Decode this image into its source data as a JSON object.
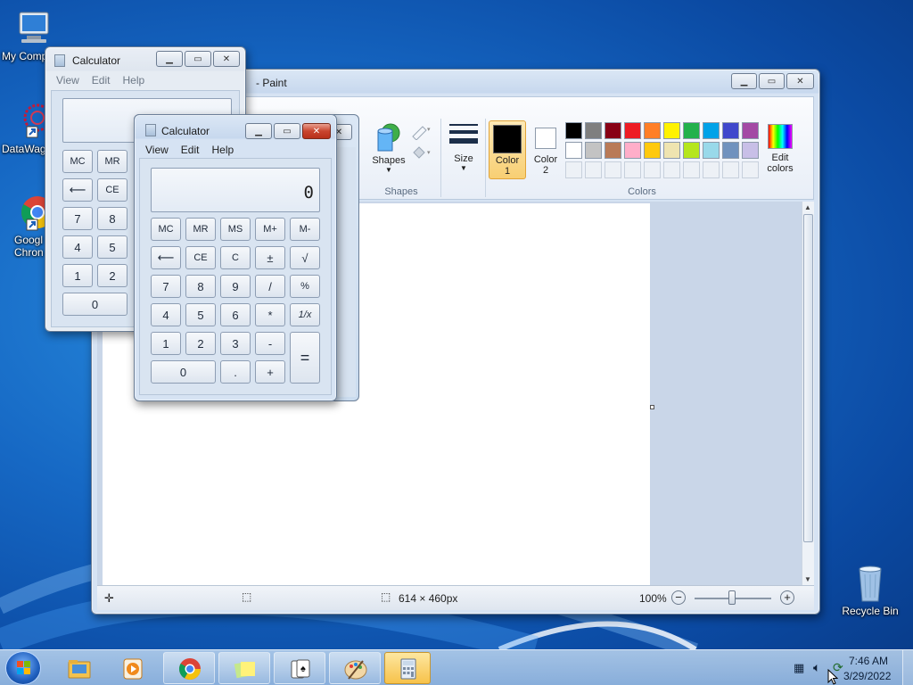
{
  "desktop": {
    "icons": [
      {
        "label": "My Comp"
      },
      {
        "label": "DataWag"
      },
      {
        "label": "Googl\nChron"
      },
      {
        "label": "Recycle Bin"
      }
    ]
  },
  "paint": {
    "title": "- Paint",
    "shapes_label": "Shapes",
    "shapes_group_label": "Shapes",
    "size_label": "Size",
    "color1_label": "Color\n1",
    "color2_label": "Color\n2",
    "edit_colors_label": "Edit\ncolors",
    "colors_group_label": "Colors",
    "palette_row1": [
      "#000000",
      "#7f7f7f",
      "#880015",
      "#ed1c24",
      "#ff7f27",
      "#fff200",
      "#22b14c",
      "#00a2e8",
      "#3f48cc",
      "#a349a4"
    ],
    "palette_row2": [
      "#ffffff",
      "#c3c3c3",
      "#b97a57",
      "#ffaec9",
      "#ffc90e",
      "#efe4b0",
      "#b5e61d",
      "#99d9ea",
      "#7092be",
      "#c8bfe7"
    ],
    "color1": "#000000",
    "color2": "#ffffff",
    "dimensions": "614 × 460px",
    "zoom": "100%"
  },
  "calc_back": {
    "title": "Calculator",
    "menu": [
      "View",
      "Edit",
      "Help"
    ],
    "keys": {
      "mc": "MC",
      "mr": "MR",
      "back": "⟵",
      "ce": "CE",
      "k7": "7",
      "k8": "8",
      "k4": "4",
      "k5": "5",
      "k1": "1",
      "k2": "2",
      "k0": "0"
    }
  },
  "calc_front": {
    "title": "Calculator",
    "menu": [
      "View",
      "Edit",
      "Help"
    ],
    "display": "0",
    "keys": {
      "mc": "MC",
      "mr": "MR",
      "ms": "MS",
      "mplus": "M+",
      "mminus": "M-",
      "back": "⟵",
      "ce": "CE",
      "c": "C",
      "pm": "±",
      "sqrt": "√",
      "k7": "7",
      "k8": "8",
      "k9": "9",
      "div": "/",
      "pct": "%",
      "k4": "4",
      "k5": "5",
      "k6": "6",
      "mul": "*",
      "inv": "1/x",
      "k1": "1",
      "k2": "2",
      "k3": "3",
      "sub": "-",
      "eq": "=",
      "k0": "0",
      "dot": ".",
      "add": "+"
    }
  },
  "tray": {
    "time": "7:46 AM",
    "date": "3/29/2022"
  }
}
